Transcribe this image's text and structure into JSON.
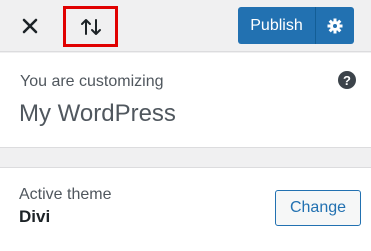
{
  "header": {
    "close_icon": "close-icon",
    "preview_icon": "arrows-up-down-icon",
    "publish_label": "Publish",
    "settings_icon": "gear-icon",
    "accent": "#2271b1",
    "highlight_color": "#e00000"
  },
  "info": {
    "customizing_label": "You are customizing",
    "site_title": "My WordPress",
    "help_icon": "help-icon",
    "help_glyph": "?"
  },
  "theme": {
    "label": "Active theme",
    "name": "Divi",
    "change_label": "Change"
  }
}
